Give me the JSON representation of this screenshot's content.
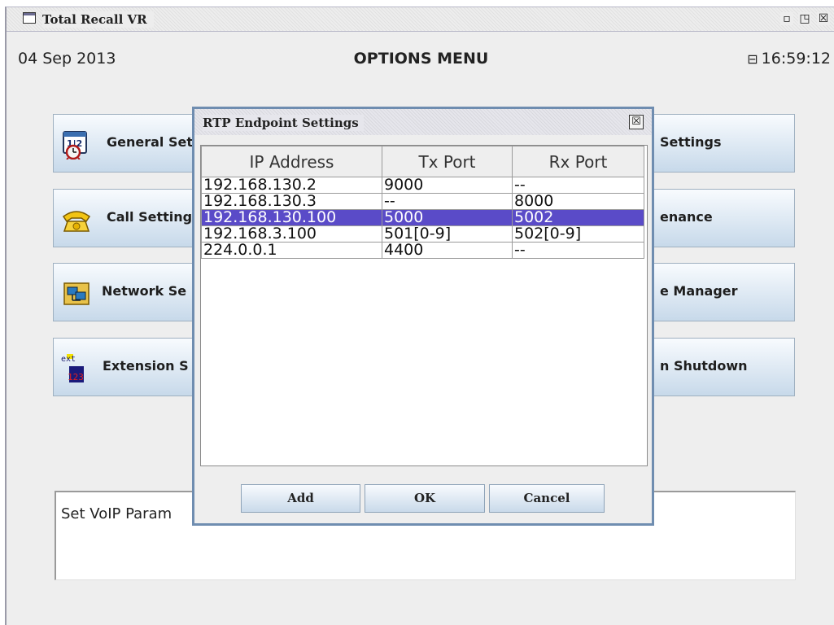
{
  "window": {
    "title": "Total Recall VR",
    "minimize_glyph": "▫",
    "restore_glyph": "◳",
    "close_glyph": "☒"
  },
  "header": {
    "date": "04 Sep 2013",
    "title": "OPTIONS MENU",
    "time": "16:59:12",
    "lock_glyph": "⊟"
  },
  "menu_left": [
    {
      "label": "General Set",
      "icon": "clock-calendar-icon"
    },
    {
      "label": "Call Setting",
      "icon": "telephone-icon"
    },
    {
      "label": "Network Se",
      "icon": "network-computers-icon"
    },
    {
      "label": "Extension S",
      "icon": "extension-123-icon"
    }
  ],
  "menu_right": [
    {
      "label": "Settings"
    },
    {
      "label": "enance"
    },
    {
      "label": "e Manager"
    },
    {
      "label": "n Shutdown"
    }
  ],
  "description": {
    "text": "Set VoIP Param"
  },
  "dialog": {
    "title": "RTP Endpoint Settings",
    "close_glyph": "☒",
    "columns": [
      "IP Address",
      "Tx Port",
      "Rx Port"
    ],
    "rows": [
      {
        "ip": "192.168.130.2",
        "tx": "9000",
        "rx": "--"
      },
      {
        "ip": "192.168.130.3",
        "tx": "--",
        "rx": "8000"
      },
      {
        "ip": "192.168.130.100",
        "tx": "5000",
        "rx": "5002"
      },
      {
        "ip": "192.168.3.100",
        "tx": "501[0-9]",
        "rx": "502[0-9]"
      },
      {
        "ip": "224.0.0.1",
        "tx": "4400",
        "rx": "--"
      }
    ],
    "selected_row": 2,
    "buttons": {
      "add": "Add",
      "ok": "OK",
      "cancel": "Cancel"
    }
  },
  "colors": {
    "selection": "#5a4bc8",
    "dialog_border": "#6f8db0",
    "button_gradient_top": "#f8fbfe",
    "button_gradient_bottom": "#c7d9ea"
  }
}
